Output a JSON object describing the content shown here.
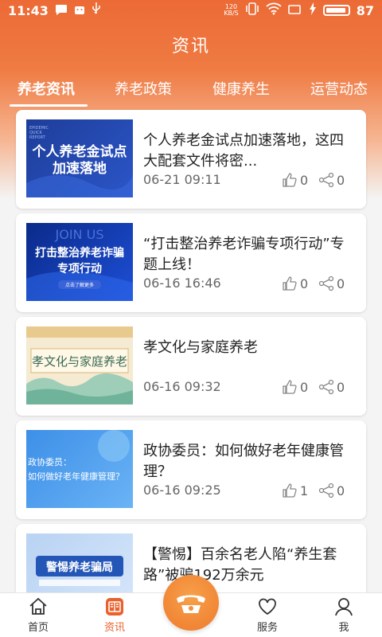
{
  "status_bar": {
    "time": "11:43",
    "net_speed_value": "120",
    "net_speed_unit": "KB/S",
    "battery": "87"
  },
  "header": {
    "title": "资讯"
  },
  "tabs": [
    {
      "label": "养老资讯",
      "active": true
    },
    {
      "label": "养老政策",
      "active": false
    },
    {
      "label": "健康养生",
      "active": false
    },
    {
      "label": "运营动态",
      "active": false
    }
  ],
  "articles": [
    {
      "title": "个人养老金试点加速落地，这四大配套文件将密...",
      "date": "06-21 09:11",
      "likes": "0",
      "shares": "0",
      "thumb_text": "个人养老金试点\n加速落地",
      "thumb_small": "EPIDEMIC\nQUICK\nREPORT"
    },
    {
      "title": "“打击整治养老诈骗专项行动”专题上线！",
      "date": "06-16 16:46",
      "likes": "0",
      "shares": "0",
      "thumb_text": "打击整治养老诈骗\n专项行动",
      "thumb_small": "点击了解更多"
    },
    {
      "title": "孝文化与家庭养老",
      "date": "06-16 09:32",
      "likes": "0",
      "shares": "0",
      "thumb_text": "孝文化与家庭养老"
    },
    {
      "title": "政协委员：如何做好老年健康管理？",
      "date": "06-16 09:25",
      "likes": "1",
      "shares": "0",
      "thumb_text": "政协委员：\n如何做好老年健康管理？"
    },
    {
      "title": "【警惕】百余名老人陷“养生套路”被骗192万余元",
      "date": "",
      "likes": "",
      "shares": "",
      "thumb_text": "警惕养老骗局"
    }
  ],
  "bottom_nav": [
    {
      "label": "首页",
      "icon": "home-icon",
      "active": false
    },
    {
      "label": "资讯",
      "icon": "news-icon",
      "active": true
    },
    {
      "label": "服务",
      "icon": "heart-icon",
      "active": false
    },
    {
      "label": "我",
      "icon": "person-icon",
      "active": false
    }
  ],
  "colors": {
    "accent": "#e9612c",
    "header_top": "#ec6a35",
    "call_button": "#f29040"
  }
}
